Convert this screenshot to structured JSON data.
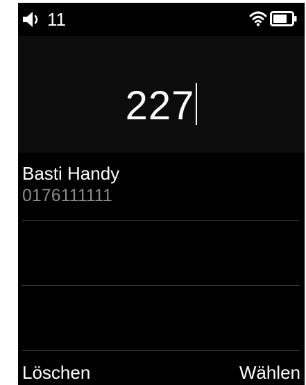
{
  "status_bar": {
    "volume_icon": "speaker-volume-icon",
    "volume_level": "11",
    "wifi_icon": "wifi-icon",
    "battery_icon": "battery-icon",
    "battery_level": 0.75
  },
  "dialer": {
    "entered_number": "227"
  },
  "contacts": [
    {
      "name": "Basti Handy",
      "number": "0176111111"
    }
  ],
  "softkeys": {
    "left_label": "Löschen",
    "right_label": "Wählen"
  }
}
